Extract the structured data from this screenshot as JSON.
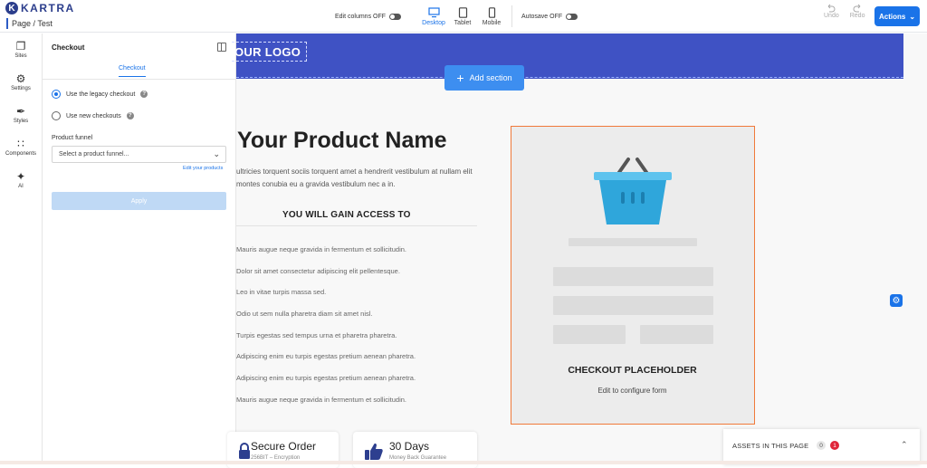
{
  "app": {
    "logo_text": "KARTRA",
    "logo_glyph": "K",
    "breadcrumb": "Page / Test"
  },
  "toolbar": {
    "edit_columns_label": "Edit columns OFF",
    "devices": [
      {
        "label": "Desktop",
        "icon": "monitor-icon",
        "active": true
      },
      {
        "label": "Tablet",
        "icon": "tablet-icon",
        "active": false
      },
      {
        "label": "Mobile",
        "icon": "mobile-icon",
        "active": false
      }
    ],
    "autosave_label": "Autosave OFF",
    "undo_label": "Undo",
    "redo_label": "Redo",
    "actions_label": "Actions",
    "accent_color": "#1a73e8"
  },
  "rail": [
    {
      "label": "Sites",
      "icon": "layers-icon"
    },
    {
      "label": "Settings",
      "icon": "gear-icon"
    },
    {
      "label": "Styles",
      "icon": "brush-icon"
    },
    {
      "label": "Components",
      "icon": "grid-icon"
    },
    {
      "label": "AI",
      "icon": "sparkle-icon"
    }
  ],
  "panel": {
    "title": "Checkout",
    "tab": "Checkout",
    "option_legacy": "Use the legacy checkout",
    "option_new": "Use new checkouts",
    "funnel_label": "Product funnel",
    "funnel_placeholder": "Select a product funnel...",
    "edit_products": "Edit your products",
    "apply": "Apply"
  },
  "canvas": {
    "logo": "OUR LOGO",
    "add_section": "Add section",
    "product_title": "Your Product Name",
    "product_desc": "ultricies torquent sociis torquent amet a hendrerit vestibulum at nullam elit montes conubia eu a gravida vestibulum nec a in.",
    "gain_title": "YOU WILL GAIN ACCESS TO",
    "bullets": [
      "Mauris augue neque gravida in fermentum et sollicitudin.",
      "Dolor sit amet consectetur adipiscing elit pellentesque.",
      "Leo in vitae turpis massa sed.",
      "Odio ut sem nulla pharetra diam sit amet nisl.",
      "Turpis egestas sed tempus urna et pharetra pharetra.",
      "Adipiscing enim eu turpis egestas pretium aenean pharetra.",
      "Adipiscing enim eu turpis egestas pretium aenean pharetra.",
      "Mauris augue neque gravida in fermentum et sollicitudin."
    ],
    "checkout_title": "CHECKOUT PLACEHOLDER",
    "checkout_sub": "Edit to configure form",
    "badge_secure_title": "Secure Order",
    "badge_secure_sub": "256BIT – Encryption",
    "badge_days_title": "30 Days",
    "badge_days_sub": "Money Back Guarantee"
  },
  "assets": {
    "label": "ASSETS IN THIS PAGE",
    "count_a": "0",
    "count_b": "1"
  },
  "colors": {
    "hero": "#3f52c4",
    "placeholder_border": "#f07a3a",
    "basket": "#3aafe0"
  }
}
